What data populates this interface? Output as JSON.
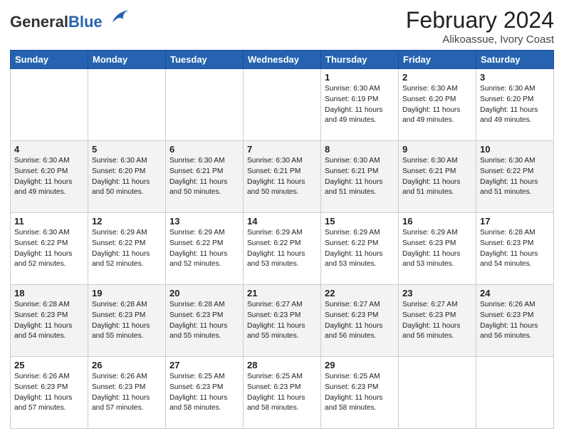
{
  "header": {
    "logo_general": "General",
    "logo_blue": "Blue",
    "title": "February 2024",
    "location": "Alikoassue, Ivory Coast"
  },
  "days_of_week": [
    "Sunday",
    "Monday",
    "Tuesday",
    "Wednesday",
    "Thursday",
    "Friday",
    "Saturday"
  ],
  "weeks": [
    [
      {
        "day": "",
        "info": ""
      },
      {
        "day": "",
        "info": ""
      },
      {
        "day": "",
        "info": ""
      },
      {
        "day": "",
        "info": ""
      },
      {
        "day": "1",
        "info": "Sunrise: 6:30 AM\nSunset: 6:19 PM\nDaylight: 11 hours\nand 49 minutes."
      },
      {
        "day": "2",
        "info": "Sunrise: 6:30 AM\nSunset: 6:20 PM\nDaylight: 11 hours\nand 49 minutes."
      },
      {
        "day": "3",
        "info": "Sunrise: 6:30 AM\nSunset: 6:20 PM\nDaylight: 11 hours\nand 49 minutes."
      }
    ],
    [
      {
        "day": "4",
        "info": "Sunrise: 6:30 AM\nSunset: 6:20 PM\nDaylight: 11 hours\nand 49 minutes."
      },
      {
        "day": "5",
        "info": "Sunrise: 6:30 AM\nSunset: 6:20 PM\nDaylight: 11 hours\nand 50 minutes."
      },
      {
        "day": "6",
        "info": "Sunrise: 6:30 AM\nSunset: 6:21 PM\nDaylight: 11 hours\nand 50 minutes."
      },
      {
        "day": "7",
        "info": "Sunrise: 6:30 AM\nSunset: 6:21 PM\nDaylight: 11 hours\nand 50 minutes."
      },
      {
        "day": "8",
        "info": "Sunrise: 6:30 AM\nSunset: 6:21 PM\nDaylight: 11 hours\nand 51 minutes."
      },
      {
        "day": "9",
        "info": "Sunrise: 6:30 AM\nSunset: 6:21 PM\nDaylight: 11 hours\nand 51 minutes."
      },
      {
        "day": "10",
        "info": "Sunrise: 6:30 AM\nSunset: 6:22 PM\nDaylight: 11 hours\nand 51 minutes."
      }
    ],
    [
      {
        "day": "11",
        "info": "Sunrise: 6:30 AM\nSunset: 6:22 PM\nDaylight: 11 hours\nand 52 minutes."
      },
      {
        "day": "12",
        "info": "Sunrise: 6:29 AM\nSunset: 6:22 PM\nDaylight: 11 hours\nand 52 minutes."
      },
      {
        "day": "13",
        "info": "Sunrise: 6:29 AM\nSunset: 6:22 PM\nDaylight: 11 hours\nand 52 minutes."
      },
      {
        "day": "14",
        "info": "Sunrise: 6:29 AM\nSunset: 6:22 PM\nDaylight: 11 hours\nand 53 minutes."
      },
      {
        "day": "15",
        "info": "Sunrise: 6:29 AM\nSunset: 6:22 PM\nDaylight: 11 hours\nand 53 minutes."
      },
      {
        "day": "16",
        "info": "Sunrise: 6:29 AM\nSunset: 6:23 PM\nDaylight: 11 hours\nand 53 minutes."
      },
      {
        "day": "17",
        "info": "Sunrise: 6:28 AM\nSunset: 6:23 PM\nDaylight: 11 hours\nand 54 minutes."
      }
    ],
    [
      {
        "day": "18",
        "info": "Sunrise: 6:28 AM\nSunset: 6:23 PM\nDaylight: 11 hours\nand 54 minutes."
      },
      {
        "day": "19",
        "info": "Sunrise: 6:28 AM\nSunset: 6:23 PM\nDaylight: 11 hours\nand 55 minutes."
      },
      {
        "day": "20",
        "info": "Sunrise: 6:28 AM\nSunset: 6:23 PM\nDaylight: 11 hours\nand 55 minutes."
      },
      {
        "day": "21",
        "info": "Sunrise: 6:27 AM\nSunset: 6:23 PM\nDaylight: 11 hours\nand 55 minutes."
      },
      {
        "day": "22",
        "info": "Sunrise: 6:27 AM\nSunset: 6:23 PM\nDaylight: 11 hours\nand 56 minutes."
      },
      {
        "day": "23",
        "info": "Sunrise: 6:27 AM\nSunset: 6:23 PM\nDaylight: 11 hours\nand 56 minutes."
      },
      {
        "day": "24",
        "info": "Sunrise: 6:26 AM\nSunset: 6:23 PM\nDaylight: 11 hours\nand 56 minutes."
      }
    ],
    [
      {
        "day": "25",
        "info": "Sunrise: 6:26 AM\nSunset: 6:23 PM\nDaylight: 11 hours\nand 57 minutes."
      },
      {
        "day": "26",
        "info": "Sunrise: 6:26 AM\nSunset: 6:23 PM\nDaylight: 11 hours\nand 57 minutes."
      },
      {
        "day": "27",
        "info": "Sunrise: 6:25 AM\nSunset: 6:23 PM\nDaylight: 11 hours\nand 58 minutes."
      },
      {
        "day": "28",
        "info": "Sunrise: 6:25 AM\nSunset: 6:23 PM\nDaylight: 11 hours\nand 58 minutes."
      },
      {
        "day": "29",
        "info": "Sunrise: 6:25 AM\nSunset: 6:23 PM\nDaylight: 11 hours\nand 58 minutes."
      },
      {
        "day": "",
        "info": ""
      },
      {
        "day": "",
        "info": ""
      }
    ]
  ]
}
